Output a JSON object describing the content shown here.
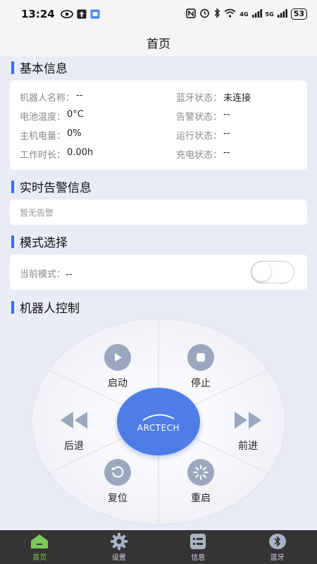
{
  "status_bar": {
    "time": "13:24",
    "net_4g": "4G",
    "net_5g": "5G",
    "battery": "53"
  },
  "header": {
    "title": "首页"
  },
  "basic_info": {
    "title": "基本信息",
    "rows": [
      {
        "label": "机器人名称：",
        "value": "--"
      },
      {
        "label": "蓝牙状态：",
        "value": "未连接"
      },
      {
        "label": "电池温度：",
        "value": "0°C"
      },
      {
        "label": "告警状态：",
        "value": "--"
      },
      {
        "label": "主机电量：",
        "value": "0%"
      },
      {
        "label": "运行状态：",
        "value": "--"
      },
      {
        "label": "工作时长：",
        "value": "0.00h"
      },
      {
        "label": "充电状态：",
        "value": "--"
      }
    ]
  },
  "alarm": {
    "title": "实时告警信息",
    "text": "暂无告警"
  },
  "mode": {
    "title": "模式选择",
    "label": "当前模式：",
    "value": "--",
    "toggle_on": false
  },
  "control": {
    "title": "机器人控制",
    "logo": "ARCTECH",
    "buttons": {
      "start": "启动",
      "stop": "停止",
      "back": "后退",
      "forward": "前进",
      "reset": "复位",
      "restart": "重启"
    }
  },
  "nav": {
    "items": [
      {
        "label": "首页",
        "icon": "home-icon",
        "active": true
      },
      {
        "label": "设置",
        "icon": "gear-icon",
        "active": false
      },
      {
        "label": "信息",
        "icon": "list-icon",
        "active": false
      },
      {
        "label": "蓝牙",
        "icon": "bluetooth-icon",
        "active": false
      }
    ]
  },
  "colors": {
    "accent": "#3b6bf0",
    "center_button": "#4f7de6",
    "icon_gray": "#9aa7bd",
    "nav_bg": "#343434",
    "nav_active": "#7ec95a"
  }
}
